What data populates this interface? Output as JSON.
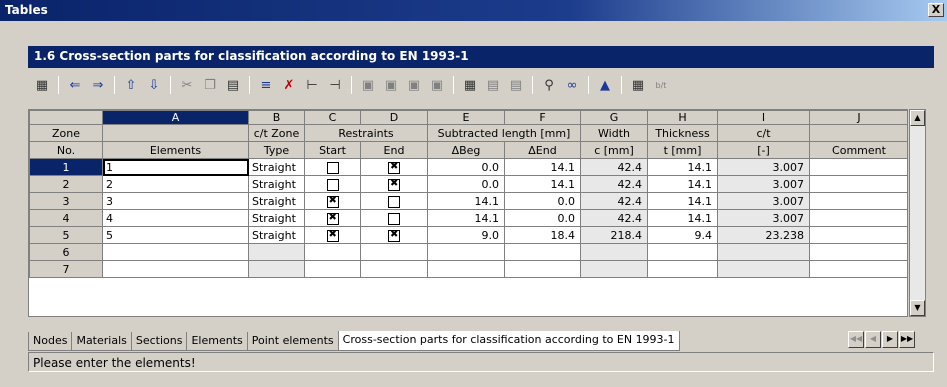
{
  "window": {
    "title": "Tables",
    "close_label": "X"
  },
  "panel": {
    "title": "1.6 Cross-section parts for classification according to EN 1993-1"
  },
  "toolbar": {
    "icons": [
      "properties-icon",
      "arrow-left-icon",
      "arrow-right-icon",
      "import-icon",
      "export-icon",
      "cut-icon",
      "copy-icon",
      "paste-icon",
      "insert-row-icon",
      "delete-row-icon",
      "insert-col-icon",
      "insert-col2-icon",
      "view1-icon",
      "view2-icon",
      "view3-icon",
      "view4-icon",
      "table1-icon",
      "table2-icon",
      "table3-icon",
      "zoom-icon",
      "link-icon",
      "graphic-icon",
      "calculator-icon",
      "bt-icon"
    ],
    "bt_label": "b/t"
  },
  "table": {
    "columns": [
      "A",
      "B",
      "C",
      "D",
      "E",
      "F",
      "G",
      "H",
      "I",
      "J"
    ],
    "header": {
      "zone_no_1": "Zone",
      "zone_no_2": "No.",
      "elements": "Elements",
      "ct_zone": "c/t Zone",
      "type": "Type",
      "restraints": "Restraints",
      "start": "Start",
      "end": "End",
      "subtracted": "Subtracted length [mm]",
      "beg": "ΔBeg",
      "end_d": "ΔEnd",
      "width": "Width",
      "c_mm": "c [mm]",
      "thickness": "Thickness",
      "t_mm": "t [mm]",
      "ct": "c/t",
      "dash": "[-]",
      "comment": "Comment"
    },
    "rows": [
      {
        "no": "1",
        "elements": "1",
        "type": "Straight",
        "start": false,
        "end": true,
        "beg": "0.0",
        "endv": "14.1",
        "width": "42.4",
        "t": "14.1",
        "ct": "3.007",
        "comment": ""
      },
      {
        "no": "2",
        "elements": "2",
        "type": "Straight",
        "start": false,
        "end": true,
        "beg": "0.0",
        "endv": "14.1",
        "width": "42.4",
        "t": "14.1",
        "ct": "3.007",
        "comment": ""
      },
      {
        "no": "3",
        "elements": "3",
        "type": "Straight",
        "start": true,
        "end": false,
        "beg": "14.1",
        "endv": "0.0",
        "width": "42.4",
        "t": "14.1",
        "ct": "3.007",
        "comment": ""
      },
      {
        "no": "4",
        "elements": "4",
        "type": "Straight",
        "start": true,
        "end": false,
        "beg": "14.1",
        "endv": "0.0",
        "width": "42.4",
        "t": "14.1",
        "ct": "3.007",
        "comment": ""
      },
      {
        "no": "5",
        "elements": "5",
        "type": "Straight",
        "start": true,
        "end": true,
        "beg": "9.0",
        "endv": "18.4",
        "width": "218.4",
        "t": "9.4",
        "ct": "23.238",
        "comment": ""
      },
      {
        "no": "6",
        "elements": "",
        "type": "",
        "start": null,
        "end": null,
        "beg": "",
        "endv": "",
        "width": "",
        "t": "",
        "ct": "",
        "comment": ""
      },
      {
        "no": "7",
        "elements": "",
        "type": "",
        "start": null,
        "end": null,
        "beg": "",
        "endv": "",
        "width": "",
        "t": "",
        "ct": "",
        "comment": ""
      }
    ]
  },
  "tabs": [
    "Nodes",
    "Materials",
    "Sections",
    "Elements",
    "Point elements",
    "Cross-section parts for classification according to EN 1993-1"
  ],
  "active_tab": 5,
  "status": "Please enter the elements!"
}
